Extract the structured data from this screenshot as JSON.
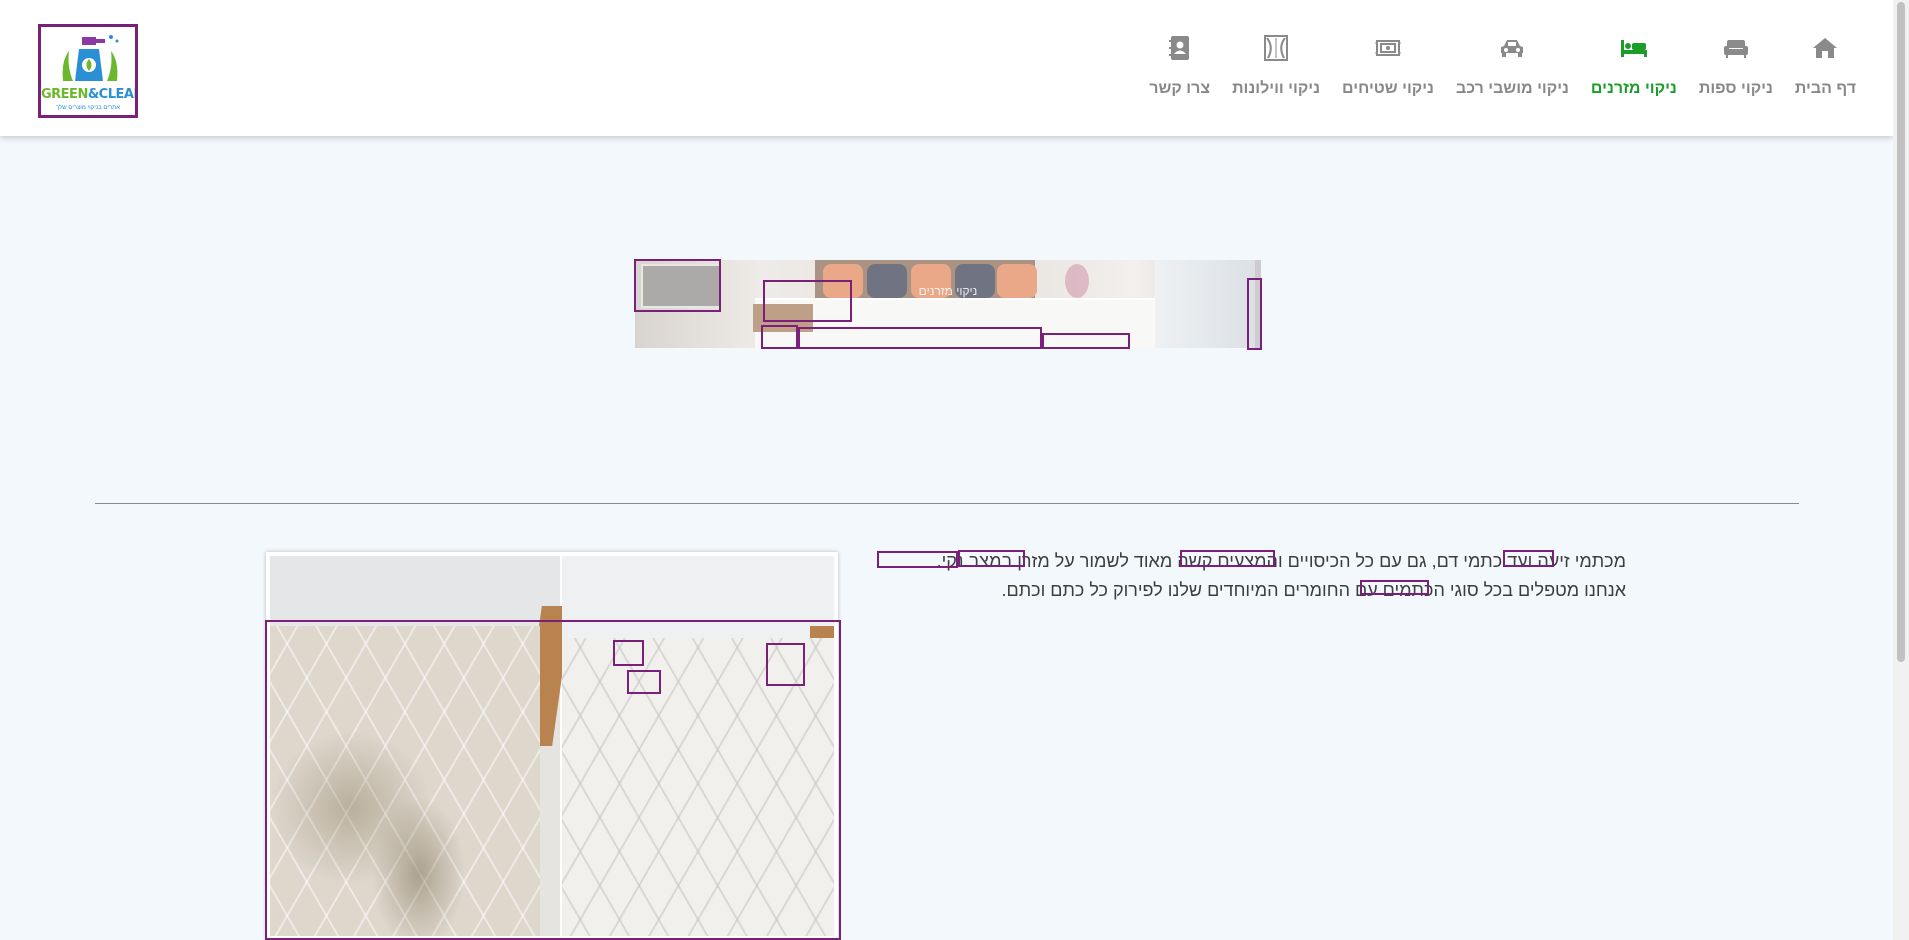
{
  "logo": {
    "brand_part1": "GREEN",
    "brand_amp": "&",
    "brand_part2": "CLEAN",
    "tagline": "אתרים בניקוי מוצרים שלך",
    "icon": "spray-bottle-with-leaves"
  },
  "nav": {
    "items": [
      {
        "label": "דף הבית",
        "icon": "home-icon",
        "active": false
      },
      {
        "label": "ניקוי ספות",
        "icon": "sofa-icon",
        "active": false
      },
      {
        "label": "ניקוי מזרנים",
        "icon": "bed-icon",
        "active": true
      },
      {
        "label": "ניקוי מושבי רכב",
        "icon": "car-icon",
        "active": false
      },
      {
        "label": "ניקוי שטיחים",
        "icon": "rug-icon",
        "active": false
      },
      {
        "label": "ניקוי ווילונות",
        "icon": "curtain-icon",
        "active": false
      },
      {
        "label": "צרו קשר",
        "icon": "contact-book-icon",
        "active": false
      }
    ]
  },
  "hero": {
    "title": "ניקוי מזרנים"
  },
  "content": {
    "line1": "מכתמי זיעה ועד כתמי דם, גם עם כל הכיסויים והמצעים קשה מאוד לשמור על מזרן במצב נקי.",
    "line2": "אנחנו מטפלים בכל סוגי הכתמים עם החומרים המיוחדים שלנו לפירוק כל כתם וכתם."
  },
  "colors": {
    "active_nav": "#1c9d2a",
    "nav_text": "#888888",
    "page_bg": "#f3f8fc",
    "highlight_box": "#7a1f7a"
  }
}
